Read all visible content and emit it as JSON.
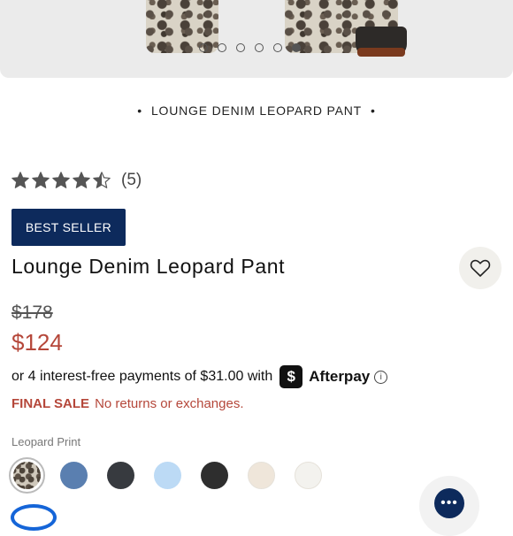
{
  "carousel": {
    "slides": 6,
    "active_index": 5
  },
  "brand_line": {
    "text": "LOUNGE DENIM LEOPARD PANT",
    "bullet": "•"
  },
  "rating": {
    "value": 4.5,
    "max": 5,
    "count_label": "(5)"
  },
  "badge": {
    "label": "BEST SELLER"
  },
  "product": {
    "title": "Lounge Denim Leopard Pant"
  },
  "price": {
    "original": "$178",
    "sale": "$124"
  },
  "afterpay": {
    "text": "or 4 interest-free payments of $31.00 with",
    "logo_glyph": "$",
    "brand": "Afterpay",
    "info_glyph": "i"
  },
  "final_sale": {
    "label": "FINAL SALE",
    "note": "No returns or exchanges."
  },
  "color": {
    "selected_label": "Leopard Print",
    "swatches": [
      {
        "name": "leopard",
        "color": "#cfc8bb",
        "selected": true
      },
      {
        "name": "blue",
        "color": "#5a7fb0"
      },
      {
        "name": "charcoal",
        "color": "#373a3f"
      },
      {
        "name": "light-blue",
        "color": "#bcdaf5"
      },
      {
        "name": "black",
        "color": "#2e2e2e"
      },
      {
        "name": "cream",
        "color": "#efe6da"
      },
      {
        "name": "white",
        "color": "#f3f2ee"
      }
    ]
  },
  "chat": {
    "glyph": "•••"
  },
  "colors": {
    "accent_navy": "#0d2a5c",
    "sale_red": "#b5473a"
  }
}
